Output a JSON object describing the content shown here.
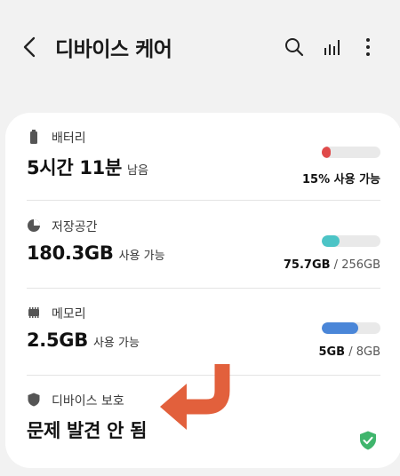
{
  "header": {
    "title": "디바이스 케어",
    "back_icon": "back-arrow-icon",
    "actions": [
      "search-icon",
      "stats-icon",
      "more-options-icon"
    ]
  },
  "items": [
    {
      "label": "배터리",
      "icon": "battery-icon",
      "value_main": "5시간 11분",
      "value_sub": "남음",
      "detail_bold": "15% 사용 가능",
      "detail_rest": "",
      "level": 0.15,
      "color": "#e04a4a"
    },
    {
      "label": "저장공간",
      "icon": "storage-pie-icon",
      "value_main": "180.3GB",
      "value_sub": "사용 가능",
      "detail_bold": "75.7GB",
      "detail_rest": " / 256GB",
      "level": 0.3,
      "color": "#4cc4c6"
    },
    {
      "label": "메모리",
      "icon": "memory-chip-icon",
      "value_main": "2.5GB",
      "value_sub": "사용 가능",
      "detail_bold": "5GB",
      "detail_rest": " / 8GB",
      "level": 0.625,
      "color": "#4a86d8"
    },
    {
      "label": "디바이스 보호",
      "icon": "shield-icon",
      "value_main": "문제 발견 안 됨",
      "status_icon": "shield-check-icon",
      "color": "#3fb56c"
    }
  ],
  "annotation": {
    "arrow_color": "#e2603c"
  }
}
